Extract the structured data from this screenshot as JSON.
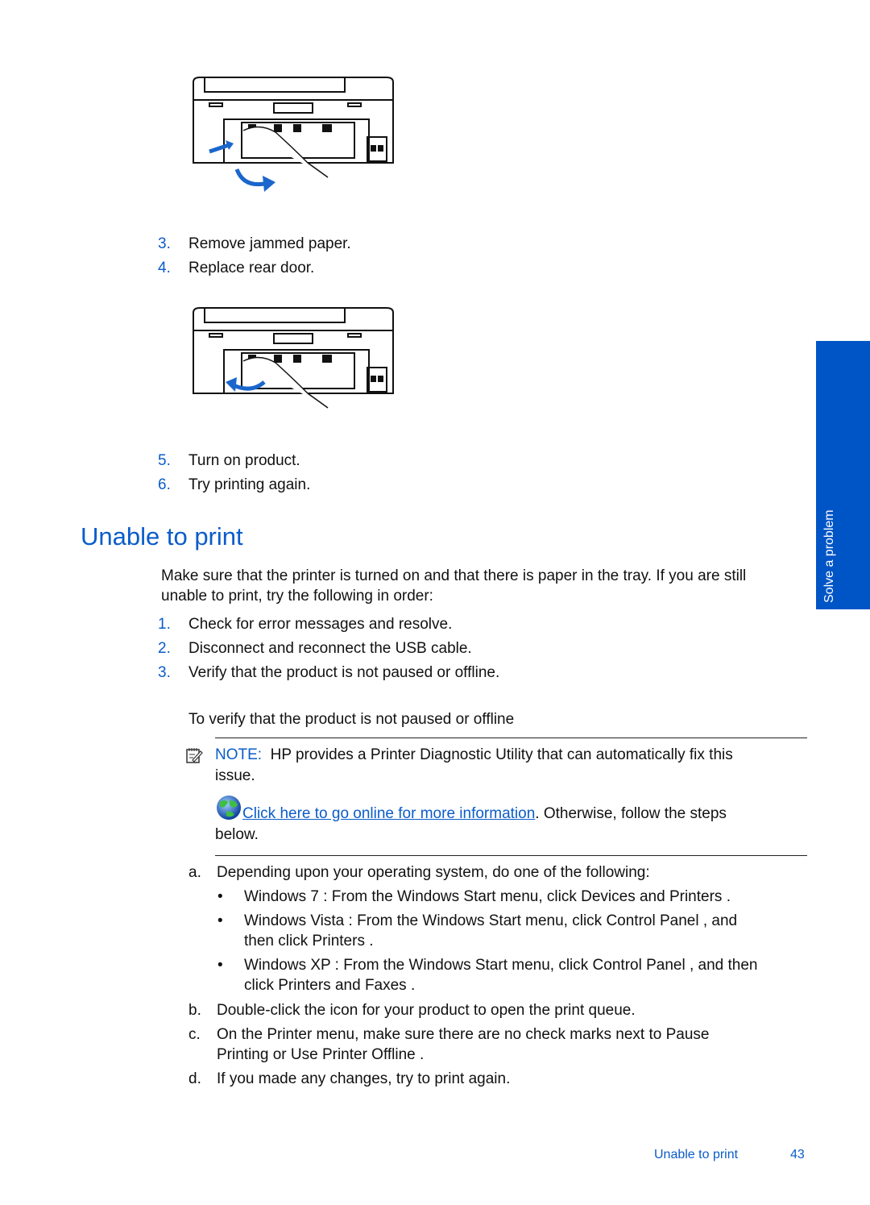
{
  "illustrations": [
    {
      "name": "printer-rear-door-open-illustration",
      "description": "Hand opening rear door of printer with blue arrows"
    },
    {
      "name": "printer-rear-door-replace-illustration",
      "description": "Hand replacing rear door of printer with blue curved arrow"
    }
  ],
  "steps_top": [
    {
      "num": "3.",
      "text": "Remove jammed paper."
    },
    {
      "num": "4.",
      "text": "Replace rear door."
    }
  ],
  "steps_mid": [
    {
      "num": "5.",
      "text": "Turn on product."
    },
    {
      "num": "6.",
      "text": "Try printing again."
    }
  ],
  "section": {
    "title": "Unable to print",
    "intro_line1": "Make sure that the printer is turned on and that there is paper in the tray. If you are still",
    "intro_line2": "unable to print, try the following in order:",
    "steps": [
      {
        "num": "1.",
        "text": "Check for error messages and resolve."
      },
      {
        "num": "2.",
        "text": "Disconnect and reconnect the USB cable."
      },
      {
        "num": "3.",
        "text": "Verify that the product is not paused or offline."
      }
    ],
    "subheading": "To verify that the product is not paused or offline"
  },
  "note": {
    "label": "NOTE:",
    "text_line1": "HP provides a Printer Diagnostic Utility that can automatically fix this",
    "text_line2": "issue.",
    "link_text": " Click here to go online for more information",
    "after_link": ". Otherwise, follow the steps",
    "after_link_line2": "below."
  },
  "substeps": {
    "a": {
      "label": "a.",
      "text": "Depending upon your operating system, do one of the following:"
    },
    "bullets": [
      {
        "line1": "Windows 7 : From the Windows Start  menu, click Devices and Printers   ."
      },
      {
        "line1": "Windows Vista  : From the Windows Start  menu, click Control Panel  , and",
        "line2": "then click Printers ."
      },
      {
        "line1": "Windows XP : From the Windows Start  menu, click Control Panel  , and then",
        "line2": "click Printers and Faxes  ."
      }
    ],
    "b": {
      "label": "b.",
      "text": "Double-click the icon for your product to open the print queue."
    },
    "c": {
      "label": "c.",
      "text_line1": "On the Printer  menu, make sure there are no check marks next to Pause",
      "text_line2": "Printing   or Use Printer Offline   ."
    },
    "d": {
      "label": "d.",
      "text": "If you made any changes, try to print again."
    }
  },
  "side_tab": {
    "label": "Solve a problem"
  },
  "footer": {
    "section": "Unable to print",
    "page": "43"
  },
  "colors": {
    "accent": "#0b5cc9",
    "tab": "#0055c6"
  }
}
